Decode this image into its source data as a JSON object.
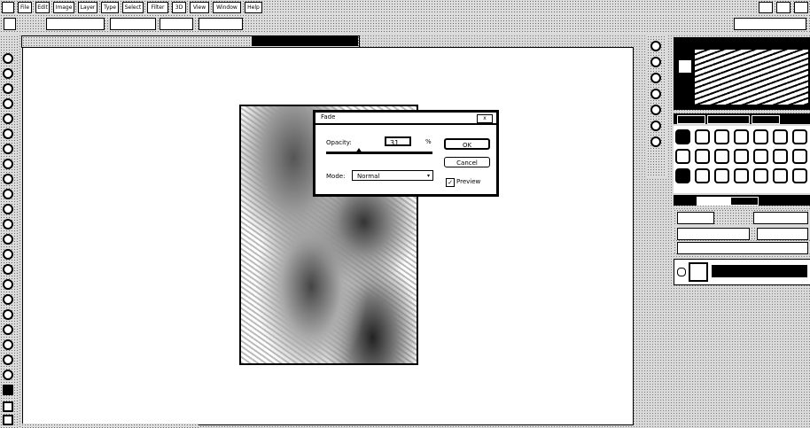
{
  "menubar": {
    "items": [
      "File",
      "Edit",
      "Image",
      "Layer",
      "Type",
      "Select",
      "Filter",
      "3D",
      "View",
      "Window",
      "Help"
    ]
  },
  "dialog": {
    "title": "Fade",
    "opacity_label": "Opacity:",
    "opacity_value": "31",
    "opacity_unit": "%",
    "opacity_fraction": 0.31,
    "mode_label": "Mode:",
    "mode_value": "Normal",
    "ok_label": "OK",
    "cancel_label": "Cancel",
    "preview_label": "Preview",
    "preview_checked": true,
    "check_mark": "✓",
    "close_glyph": "x",
    "select_arrow": "▾"
  },
  "icons": {
    "tools": [
      "move-tool-icon",
      "marquee-tool-icon",
      "lasso-tool-icon",
      "quick-select-icon",
      "crop-tool-icon",
      "eyedropper-icon",
      "healing-brush-icon",
      "brush-tool-icon",
      "clone-stamp-icon",
      "history-brush-icon",
      "eraser-icon",
      "gradient-icon",
      "blur-icon",
      "dodge-icon",
      "pen-tool-icon",
      "type-tool-icon",
      "path-select-icon",
      "shape-tool-icon",
      "3d-rotate-icon",
      "3d-orbit-icon",
      "hand-tool-icon",
      "zoom-tool-icon",
      "foreground-color-icon",
      "quick-mask-icon",
      "screen-mode-icon"
    ]
  },
  "colors": {
    "background": "#d9d9d9",
    "dialog": "#ffffff",
    "border": "#000000"
  }
}
